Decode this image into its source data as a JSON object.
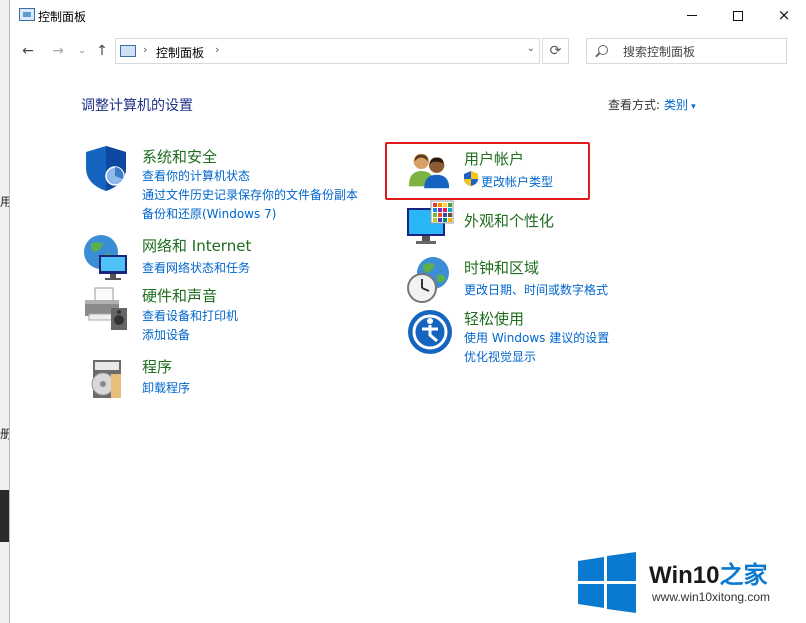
{
  "window": {
    "title": "控制面板",
    "controls": {
      "minimize": "minimize",
      "maximize": "maximize",
      "close": "×"
    }
  },
  "background_fragments": [
    "用",
    "册"
  ],
  "navigation": {
    "back": "←",
    "forward": "→",
    "recent": "⌄",
    "up": "↑",
    "breadcrumb": [
      "控制面板"
    ],
    "separator": "›",
    "dropdown": "⌄",
    "refresh": "⟳"
  },
  "search": {
    "placeholder": "搜索控制面板",
    "value": ""
  },
  "content": {
    "heading": "调整计算机的设置",
    "view_by_label": "查看方式:",
    "view_by_value": "类别",
    "view_by_arrow": "▾"
  },
  "categories": [
    {
      "title": "系统和安全",
      "icon": "shield-icon",
      "links": [
        "查看你的计算机状态",
        "通过文件历史记录保存你的文件备份副本",
        "备份和还原(Windows 7)"
      ]
    },
    {
      "title": "网络和 Internet",
      "icon": "globe-network-icon",
      "links": [
        "查看网络状态和任务"
      ]
    },
    {
      "title": "硬件和声音",
      "icon": "printer-speaker-icon",
      "links": [
        "查看设备和打印机",
        "添加设备"
      ]
    },
    {
      "title": "程序",
      "icon": "programs-disc-icon",
      "links": [
        "卸载程序"
      ]
    },
    {
      "title": "用户帐户",
      "icon": "users-icon",
      "links": [
        "更改帐户类型"
      ],
      "highlighted": true
    },
    {
      "title": "外观和个性化",
      "icon": "monitor-palette-icon",
      "links": []
    },
    {
      "title": "时钟和区域",
      "icon": "clock-globe-icon",
      "links": [
        "更改日期、时间或数字格式"
      ]
    },
    {
      "title": "轻松使用",
      "icon": "ease-of-access-icon",
      "links": [
        "使用 Windows 建议的设置",
        "优化视觉显示"
      ]
    }
  ],
  "watermark": {
    "brand": "Win10",
    "brand_suffix": "之家",
    "url": "www.win10xitong.com"
  },
  "colors": {
    "heading": "#1e3287",
    "category_title": "#1f6d1f",
    "link": "#0066cc",
    "highlight_box": "#e01b1b",
    "win_logo": "#0a7ad0"
  }
}
